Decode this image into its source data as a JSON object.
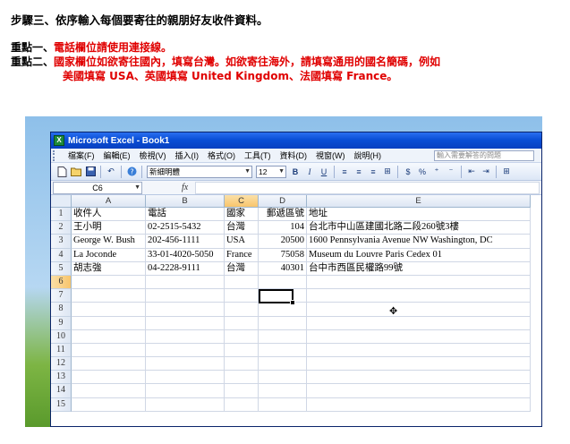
{
  "instructions": {
    "step": "步驟三、依序輸入每個要寄往的親朋好友收件資料。",
    "point1_label": "重點一、",
    "point1_text": "電話欄位請使用連接線。",
    "point2_label": "重點二、",
    "point2_text": "國家欄位如欲寄往國內，填寫台灣。如欲寄往海外，請填寫通用的國名簡碼，例如",
    "point2_cont": "美國填寫 USA、英國填寫 United Kingdom、法國填寫 France。"
  },
  "window": {
    "title": "Microsoft Excel - Book1",
    "app_icon": "X"
  },
  "menu": {
    "items": [
      "檔案(F)",
      "編輯(E)",
      "檢視(V)",
      "插入(I)",
      "格式(O)",
      "工具(T)",
      "資料(D)",
      "視窗(W)",
      "說明(H)"
    ],
    "help_placeholder": "輸入需要解答的問題"
  },
  "toolbar": {
    "font": "新細明體",
    "size": "12",
    "bold": "B",
    "italic": "I",
    "underline": "U",
    "currency": "$",
    "percent": "%"
  },
  "formula_bar": {
    "name_box": "C6",
    "fx": "fx"
  },
  "sheet": {
    "columns": [
      "A",
      "B",
      "C",
      "D",
      "E"
    ],
    "selected_column": "C",
    "selected_row": 6,
    "rows": [
      {
        "n": "1",
        "a": "收件人",
        "b": "電話",
        "c": "國家",
        "d": "郵遞區號",
        "e": "地址"
      },
      {
        "n": "2",
        "a": "王小明",
        "b": "02-2515-5432",
        "c": "台灣",
        "d": "104",
        "e": "台北市中山區建國北路二段260號3樓"
      },
      {
        "n": "3",
        "a": "George W. Bush",
        "b": "202-456-1111",
        "c": "USA",
        "d": "20500",
        "e": "1600 Pennsylvania Avenue NW Washington, DC"
      },
      {
        "n": "4",
        "a": "La Joconde",
        "b": "33-01-4020-5050",
        "c": "France",
        "d": "75058",
        "e": "Museum du Louvre Paris Cedex 01"
      },
      {
        "n": "5",
        "a": "胡志強",
        "b": "04-2228-9111",
        "c": "台灣",
        "d": "40301",
        "e": "台中市西區民權路99號"
      },
      {
        "n": "6",
        "a": "",
        "b": "",
        "c": "",
        "d": "",
        "e": ""
      },
      {
        "n": "7",
        "a": "",
        "b": "",
        "c": "",
        "d": "",
        "e": ""
      },
      {
        "n": "8",
        "a": "",
        "b": "",
        "c": "",
        "d": "",
        "e": ""
      },
      {
        "n": "9",
        "a": "",
        "b": "",
        "c": "",
        "d": "",
        "e": ""
      },
      {
        "n": "10",
        "a": "",
        "b": "",
        "c": "",
        "d": "",
        "e": ""
      },
      {
        "n": "11",
        "a": "",
        "b": "",
        "c": "",
        "d": "",
        "e": ""
      },
      {
        "n": "12",
        "a": "",
        "b": "",
        "c": "",
        "d": "",
        "e": ""
      },
      {
        "n": "13",
        "a": "",
        "b": "",
        "c": "",
        "d": "",
        "e": ""
      },
      {
        "n": "14",
        "a": "",
        "b": "",
        "c": "",
        "d": "",
        "e": ""
      },
      {
        "n": "15",
        "a": "",
        "b": "",
        "c": "",
        "d": "",
        "e": ""
      }
    ]
  },
  "cursor_icon": "cross-cursor-icon"
}
